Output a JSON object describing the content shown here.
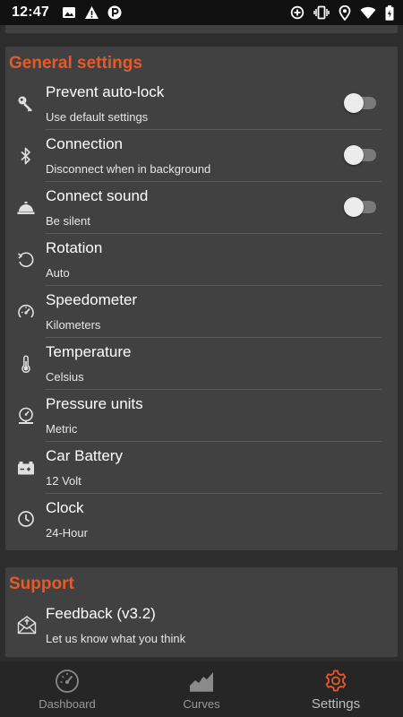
{
  "status_bar": {
    "time": "12:47",
    "left_icons": [
      "image-icon",
      "warning-icon",
      "parking-icon"
    ],
    "right_icons": [
      "data-saver-icon",
      "vibrate-icon",
      "location-icon",
      "wifi-icon",
      "battery-icon"
    ]
  },
  "general_settings": {
    "title": "General settings",
    "items": [
      {
        "icon": "key-icon",
        "title": "Prevent auto-lock",
        "subtitle": "Use default settings",
        "toggle": false
      },
      {
        "icon": "bluetooth-icon",
        "title": "Connection",
        "subtitle": "Disconnect when in background",
        "toggle": false
      },
      {
        "icon": "bell-icon",
        "title": "Connect sound",
        "subtitle": "Be silent",
        "toggle": false
      },
      {
        "icon": "rotation-icon",
        "title": "Rotation",
        "subtitle": "Auto"
      },
      {
        "icon": "speedometer-icon",
        "title": "Speedometer",
        "subtitle": "Kilometers"
      },
      {
        "icon": "thermometer-icon",
        "title": "Temperature",
        "subtitle": "Celsius"
      },
      {
        "icon": "pressure-gauge-icon",
        "title": "Pressure units",
        "subtitle": "Metric"
      },
      {
        "icon": "car-battery-icon",
        "title": "Car Battery",
        "subtitle": "12 Volt"
      },
      {
        "icon": "clock-icon",
        "title": "Clock",
        "subtitle": "24-Hour"
      }
    ]
  },
  "support": {
    "title": "Support",
    "items": [
      {
        "icon": "feedback-mail-icon",
        "title": "Feedback (v3.2)",
        "subtitle": "Let us know what you think"
      }
    ]
  },
  "bottom_nav": {
    "items": [
      {
        "icon": "dashboard-gauge-icon",
        "label": "Dashboard"
      },
      {
        "icon": "curves-icon",
        "label": "Curves"
      },
      {
        "icon": "settings-gear-icon",
        "label": "Settings",
        "active": true
      }
    ]
  },
  "colors": {
    "accent": "#e8592a",
    "card_background": "#414141",
    "page_background": "#2d2d2d",
    "status_bar": "#111111",
    "bottom_nav": "#262626"
  }
}
